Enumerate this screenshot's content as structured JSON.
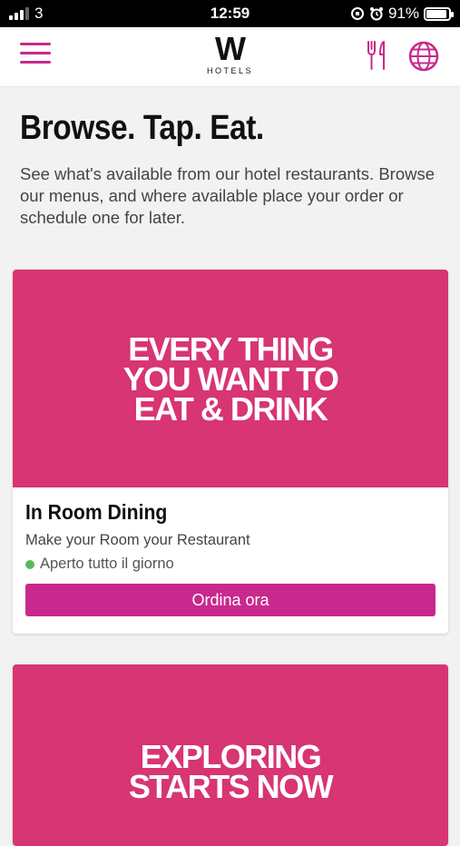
{
  "status_bar": {
    "carrier": "3",
    "time": "12:59",
    "battery": "91%",
    "battery_level": 0.91
  },
  "nav": {
    "logo_mark": "W",
    "logo_sub": "HOTELS",
    "menu_icon": "hamburger-menu-icon",
    "dining_icon": "fork-knife-icon",
    "language_icon": "globe-icon",
    "accent_color": "#c8298c"
  },
  "page": {
    "title": "Browse. Tap. Eat.",
    "intro": "See what's available from our hotel restaurants. Browse our menus, and where available place your order or schedule one for later."
  },
  "cards": [
    {
      "banner_text": "EVERY THING\nYOU WANT TO\nEAT & DRINK",
      "banner_color": "#d73573",
      "title": "In Room Dining",
      "description": "Make your Room your Restaurant",
      "status": "Aperto tutto il giorno",
      "status_color": "#5cb85c",
      "button_label": "Ordina ora"
    },
    {
      "banner_text": "EXPLORING\nSTARTS NOW",
      "banner_color": "#d73573"
    }
  ]
}
